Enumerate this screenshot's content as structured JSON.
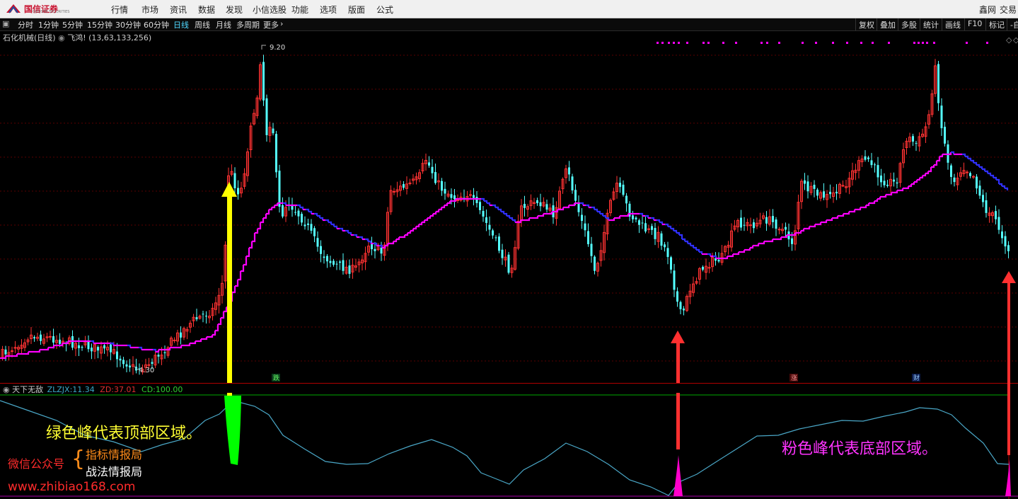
{
  "menu": {
    "logo_text": "国信证券",
    "logo_sub": "GUOSEN SECURITIES",
    "items": [
      "行情",
      "市场",
      "资讯",
      "数据",
      "发现",
      "小信选股",
      "功能",
      "选项",
      "版面",
      "公式"
    ],
    "right_items": [
      "鑫网",
      "交易"
    ]
  },
  "toolbar": {
    "periods": [
      "分时",
      "1分钟",
      "5分钟",
      "15分钟",
      "30分钟",
      "60分钟",
      "日线",
      "周线",
      "月线",
      "多周期",
      "更多"
    ],
    "active": "日线",
    "right": [
      "复权",
      "叠加",
      "多股",
      "统计",
      "画线",
      "F10",
      "标记",
      "-自"
    ]
  },
  "stock": {
    "name": "石化机械(日线)",
    "indicator": "飞鸿!",
    "params": "(13,63,133,256)",
    "high_label": "9.20",
    "low_label": "4.30",
    "markers": [
      "跌",
      "涨",
      "财"
    ]
  },
  "indicator_panel": {
    "name": "天下无敌",
    "zlzjx_label": "ZLZJX:",
    "zlzjx_value": "11.34",
    "zd_label": "ZD:",
    "zd_value": "37.01",
    "cd_label": "CD:",
    "cd_value": "100.00"
  },
  "annotations": {
    "green_text": "绿色峰代表顶部区域。",
    "pink_text": "粉色峰代表底部区域。",
    "wechat_label": "微信公众号",
    "bureau1": "指标情报局",
    "bureau2": "战法情报局",
    "website": "www.zhibiao168.com"
  },
  "colors": {
    "up": "#ff3232",
    "down": "#54ffff",
    "ma_up": "#ff00ff",
    "ma_down": "#3030ff",
    "yellow_arrow": "#ffff00",
    "red_arrow": "#ff3030",
    "green_peak": "#00ff00",
    "pink_peak": "#ff00cc",
    "osc_line": "#4aa7c7"
  }
}
